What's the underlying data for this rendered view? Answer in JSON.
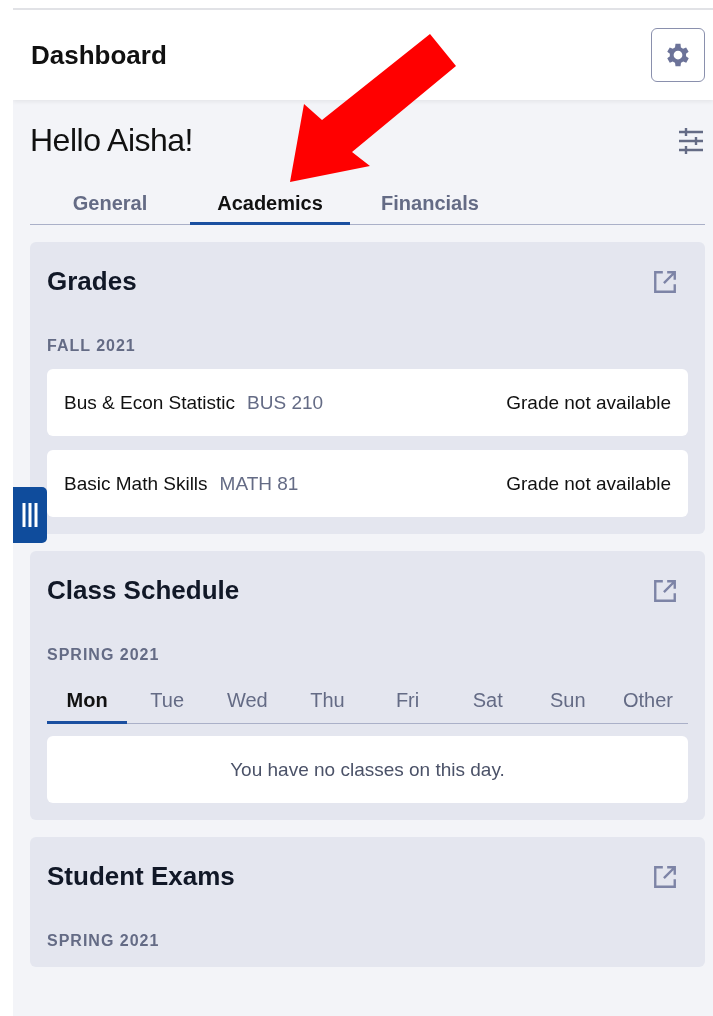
{
  "header": {
    "title": "Dashboard"
  },
  "greeting": "Hello Aisha!",
  "tabs": [
    {
      "label": "General",
      "selected": false
    },
    {
      "label": "Academics",
      "selected": true
    },
    {
      "label": "Financials",
      "selected": false
    }
  ],
  "cards": [
    {
      "title": "Grades",
      "term": "FALL 2021",
      "kind": "grades",
      "rows": [
        {
          "course": "Bus & Econ Statistic",
          "code": "BUS 210",
          "grade": "Grade not available"
        },
        {
          "course": "Basic Math Skills",
          "code": "MATH 81",
          "grade": "Grade not available"
        }
      ]
    },
    {
      "title": "Class Schedule",
      "term": "SPRING 2021",
      "kind": "schedule",
      "days": [
        {
          "label": "Mon",
          "selected": true
        },
        {
          "label": "Tue",
          "selected": false
        },
        {
          "label": "Wed",
          "selected": false
        },
        {
          "label": "Thu",
          "selected": false
        },
        {
          "label": "Fri",
          "selected": false
        },
        {
          "label": "Sat",
          "selected": false
        },
        {
          "label": "Sun",
          "selected": false
        },
        {
          "label": "Other",
          "selected": false
        }
      ],
      "message": "You have no classes on this day."
    },
    {
      "title": "Student Exams",
      "term": "SPRING 2021",
      "kind": "exams"
    }
  ]
}
